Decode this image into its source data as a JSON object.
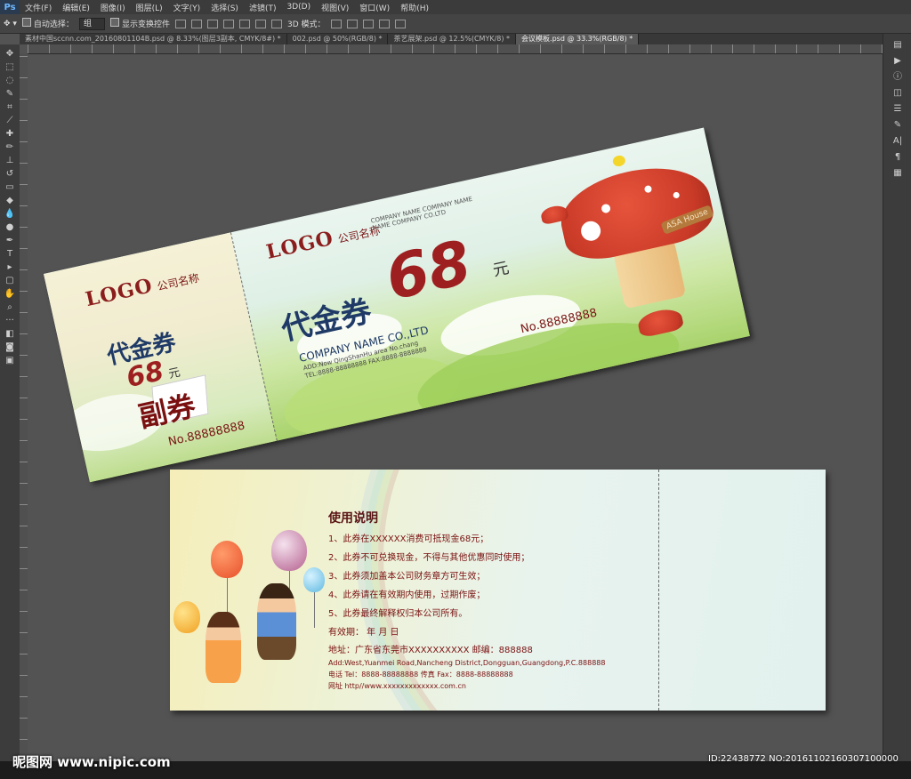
{
  "app": {
    "logo": "Ps",
    "menus": [
      "文件(F)",
      "编辑(E)",
      "图像(I)",
      "图层(L)",
      "文字(Y)",
      "选择(S)",
      "滤镜(T)",
      "3D(D)",
      "视图(V)",
      "窗口(W)",
      "帮助(H)"
    ]
  },
  "options": {
    "auto_select_label": "自动选择：",
    "auto_select_value": "组",
    "show_transform_label": "显示变换控件",
    "mode_3d_label": "3D 模式："
  },
  "tabs": [
    {
      "label": "素材中国sccnn.com_20160801104B.psd @ 8.33%(图层3副本, CMYK/8#) *",
      "active": false
    },
    {
      "label": "002.psd @ 50%(RGB/8) *",
      "active": false
    },
    {
      "label": "茶艺展架.psd @ 12.5%(CMYK/8) *",
      "active": false
    },
    {
      "label": "会议模板.psd @ 33.3%(RGB/8) *",
      "active": true
    }
  ],
  "ticket": {
    "stub": {
      "logo": "LOGO",
      "company": "公司名称",
      "title": "代金券",
      "amount": "68",
      "unit": "元",
      "copy_label": "副券",
      "number": "No.88888888"
    },
    "main": {
      "logo": "LOGO",
      "company": "公司名称",
      "company_en_1": "COMPANY NAME COMPANY NAME",
      "company_en_2": "NAME COMPANY CO.LTD",
      "title": "代金券",
      "amount": "68",
      "unit": "元",
      "company_full": "COMPANY NAME CO.,LTD",
      "address": "ADD:Now QingShanHu area No.chang",
      "tel_fax": "TEL:8888-88888888  FAX:8888-8888888",
      "number": "No.88888888",
      "sign_text": "ASA House"
    }
  },
  "back": {
    "heading": "使用说明",
    "rules": [
      "1、此券在XXXXXX消费可抵现金68元；",
      "2、此券不可兑换现金，不得与其他优惠同时使用；",
      "3、此券须加盖本公司财务章方可生效；",
      "4、此券请在有效期内使用，过期作废；",
      "5、此券最终解释权归本公司所有。"
    ],
    "validity": "有效期：      年    月    日",
    "address": "地址：广东省东莞市XXXXXXXXXX      邮编：888888",
    "address_en": "Add:West,Yuanmei Road,Nancheng District,Dongguan,Guangdong,P.C.888888",
    "phone": "电话 Tel：8888-88888888          传真 Fax：8888-88888888",
    "web": "网址 http//www.xxxxxxxxxxxxx.com.cn"
  },
  "watermark": {
    "left": "昵图网 www.nipic.com",
    "right": "ID:22438772 NO:20161102160307100000"
  }
}
